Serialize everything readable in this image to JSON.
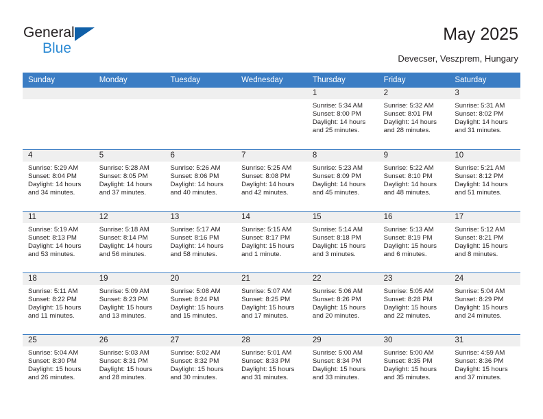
{
  "brand": {
    "name_part1": "General",
    "name_part2": "Blue",
    "triangle_color": "#1060a8",
    "blue_color": "#2e8bd4"
  },
  "header": {
    "title": "May 2025",
    "subtitle": "Devecser, Veszprem, Hungary"
  },
  "theme": {
    "header_bar_color": "#3b7dc4",
    "day_strip_color": "#efefef",
    "text_color": "#231f20"
  },
  "weekdays": [
    "Sunday",
    "Monday",
    "Tuesday",
    "Wednesday",
    "Thursday",
    "Friday",
    "Saturday"
  ],
  "labels": {
    "sunrise": "Sunrise:",
    "sunset": "Sunset:",
    "daylight": "Daylight:"
  },
  "weeks": [
    [
      {
        "day": "",
        "empty": true
      },
      {
        "day": "",
        "empty": true
      },
      {
        "day": "",
        "empty": true
      },
      {
        "day": "",
        "empty": true
      },
      {
        "day": "1",
        "sunrise": "Sunrise: 5:34 AM",
        "sunset": "Sunset: 8:00 PM",
        "daylight_line1": "Daylight: 14 hours",
        "daylight_line2": "and 25 minutes."
      },
      {
        "day": "2",
        "sunrise": "Sunrise: 5:32 AM",
        "sunset": "Sunset: 8:01 PM",
        "daylight_line1": "Daylight: 14 hours",
        "daylight_line2": "and 28 minutes."
      },
      {
        "day": "3",
        "sunrise": "Sunrise: 5:31 AM",
        "sunset": "Sunset: 8:02 PM",
        "daylight_line1": "Daylight: 14 hours",
        "daylight_line2": "and 31 minutes."
      }
    ],
    [
      {
        "day": "4",
        "sunrise": "Sunrise: 5:29 AM",
        "sunset": "Sunset: 8:04 PM",
        "daylight_line1": "Daylight: 14 hours",
        "daylight_line2": "and 34 minutes."
      },
      {
        "day": "5",
        "sunrise": "Sunrise: 5:28 AM",
        "sunset": "Sunset: 8:05 PM",
        "daylight_line1": "Daylight: 14 hours",
        "daylight_line2": "and 37 minutes."
      },
      {
        "day": "6",
        "sunrise": "Sunrise: 5:26 AM",
        "sunset": "Sunset: 8:06 PM",
        "daylight_line1": "Daylight: 14 hours",
        "daylight_line2": "and 40 minutes."
      },
      {
        "day": "7",
        "sunrise": "Sunrise: 5:25 AM",
        "sunset": "Sunset: 8:08 PM",
        "daylight_line1": "Daylight: 14 hours",
        "daylight_line2": "and 42 minutes."
      },
      {
        "day": "8",
        "sunrise": "Sunrise: 5:23 AM",
        "sunset": "Sunset: 8:09 PM",
        "daylight_line1": "Daylight: 14 hours",
        "daylight_line2": "and 45 minutes."
      },
      {
        "day": "9",
        "sunrise": "Sunrise: 5:22 AM",
        "sunset": "Sunset: 8:10 PM",
        "daylight_line1": "Daylight: 14 hours",
        "daylight_line2": "and 48 minutes."
      },
      {
        "day": "10",
        "sunrise": "Sunrise: 5:21 AM",
        "sunset": "Sunset: 8:12 PM",
        "daylight_line1": "Daylight: 14 hours",
        "daylight_line2": "and 51 minutes."
      }
    ],
    [
      {
        "day": "11",
        "sunrise": "Sunrise: 5:19 AM",
        "sunset": "Sunset: 8:13 PM",
        "daylight_line1": "Daylight: 14 hours",
        "daylight_line2": "and 53 minutes."
      },
      {
        "day": "12",
        "sunrise": "Sunrise: 5:18 AM",
        "sunset": "Sunset: 8:14 PM",
        "daylight_line1": "Daylight: 14 hours",
        "daylight_line2": "and 56 minutes."
      },
      {
        "day": "13",
        "sunrise": "Sunrise: 5:17 AM",
        "sunset": "Sunset: 8:16 PM",
        "daylight_line1": "Daylight: 14 hours",
        "daylight_line2": "and 58 minutes."
      },
      {
        "day": "14",
        "sunrise": "Sunrise: 5:15 AM",
        "sunset": "Sunset: 8:17 PM",
        "daylight_line1": "Daylight: 15 hours",
        "daylight_line2": "and 1 minute."
      },
      {
        "day": "15",
        "sunrise": "Sunrise: 5:14 AM",
        "sunset": "Sunset: 8:18 PM",
        "daylight_line1": "Daylight: 15 hours",
        "daylight_line2": "and 3 minutes."
      },
      {
        "day": "16",
        "sunrise": "Sunrise: 5:13 AM",
        "sunset": "Sunset: 8:19 PM",
        "daylight_line1": "Daylight: 15 hours",
        "daylight_line2": "and 6 minutes."
      },
      {
        "day": "17",
        "sunrise": "Sunrise: 5:12 AM",
        "sunset": "Sunset: 8:21 PM",
        "daylight_line1": "Daylight: 15 hours",
        "daylight_line2": "and 8 minutes."
      }
    ],
    [
      {
        "day": "18",
        "sunrise": "Sunrise: 5:11 AM",
        "sunset": "Sunset: 8:22 PM",
        "daylight_line1": "Daylight: 15 hours",
        "daylight_line2": "and 11 minutes."
      },
      {
        "day": "19",
        "sunrise": "Sunrise: 5:09 AM",
        "sunset": "Sunset: 8:23 PM",
        "daylight_line1": "Daylight: 15 hours",
        "daylight_line2": "and 13 minutes."
      },
      {
        "day": "20",
        "sunrise": "Sunrise: 5:08 AM",
        "sunset": "Sunset: 8:24 PM",
        "daylight_line1": "Daylight: 15 hours",
        "daylight_line2": "and 15 minutes."
      },
      {
        "day": "21",
        "sunrise": "Sunrise: 5:07 AM",
        "sunset": "Sunset: 8:25 PM",
        "daylight_line1": "Daylight: 15 hours",
        "daylight_line2": "and 17 minutes."
      },
      {
        "day": "22",
        "sunrise": "Sunrise: 5:06 AM",
        "sunset": "Sunset: 8:26 PM",
        "daylight_line1": "Daylight: 15 hours",
        "daylight_line2": "and 20 minutes."
      },
      {
        "day": "23",
        "sunrise": "Sunrise: 5:05 AM",
        "sunset": "Sunset: 8:28 PM",
        "daylight_line1": "Daylight: 15 hours",
        "daylight_line2": "and 22 minutes."
      },
      {
        "day": "24",
        "sunrise": "Sunrise: 5:04 AM",
        "sunset": "Sunset: 8:29 PM",
        "daylight_line1": "Daylight: 15 hours",
        "daylight_line2": "and 24 minutes."
      }
    ],
    [
      {
        "day": "25",
        "sunrise": "Sunrise: 5:04 AM",
        "sunset": "Sunset: 8:30 PM",
        "daylight_line1": "Daylight: 15 hours",
        "daylight_line2": "and 26 minutes."
      },
      {
        "day": "26",
        "sunrise": "Sunrise: 5:03 AM",
        "sunset": "Sunset: 8:31 PM",
        "daylight_line1": "Daylight: 15 hours",
        "daylight_line2": "and 28 minutes."
      },
      {
        "day": "27",
        "sunrise": "Sunrise: 5:02 AM",
        "sunset": "Sunset: 8:32 PM",
        "daylight_line1": "Daylight: 15 hours",
        "daylight_line2": "and 30 minutes."
      },
      {
        "day": "28",
        "sunrise": "Sunrise: 5:01 AM",
        "sunset": "Sunset: 8:33 PM",
        "daylight_line1": "Daylight: 15 hours",
        "daylight_line2": "and 31 minutes."
      },
      {
        "day": "29",
        "sunrise": "Sunrise: 5:00 AM",
        "sunset": "Sunset: 8:34 PM",
        "daylight_line1": "Daylight: 15 hours",
        "daylight_line2": "and 33 minutes."
      },
      {
        "day": "30",
        "sunrise": "Sunrise: 5:00 AM",
        "sunset": "Sunset: 8:35 PM",
        "daylight_line1": "Daylight: 15 hours",
        "daylight_line2": "and 35 minutes."
      },
      {
        "day": "31",
        "sunrise": "Sunrise: 4:59 AM",
        "sunset": "Sunset: 8:36 PM",
        "daylight_line1": "Daylight: 15 hours",
        "daylight_line2": "and 37 minutes."
      }
    ]
  ]
}
